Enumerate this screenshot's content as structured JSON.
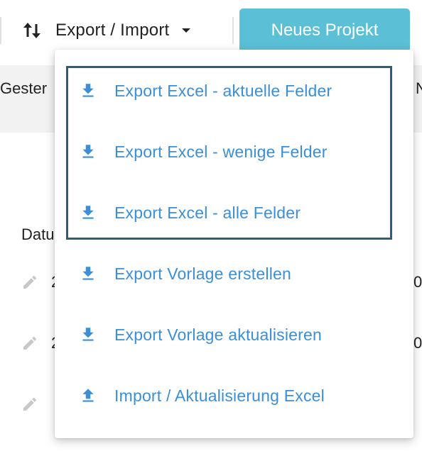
{
  "toolbar": {
    "export_import_label": "Export / Import",
    "new_project_label": "Neues Projekt"
  },
  "background": {
    "header_cell": "Gester",
    "header_cell_right": "N",
    "column_label": "Datu",
    "row_values": [
      "2",
      "2"
    ],
    "row_right_values": [
      "0",
      "0"
    ]
  },
  "dropdown": {
    "items": [
      {
        "label": "Export Excel - aktuelle Felder",
        "icon": "download-icon"
      },
      {
        "label": "Export Excel - wenige Felder",
        "icon": "download-icon"
      },
      {
        "label": "Export Excel - alle Felder",
        "icon": "download-icon"
      },
      {
        "label": "Export Vorlage erstellen",
        "icon": "download-icon"
      },
      {
        "label": "Export Vorlage aktualisieren",
        "icon": "download-icon"
      },
      {
        "label": "Import / Aktualisierung Excel",
        "icon": "upload-icon"
      }
    ]
  },
  "colors": {
    "accent": "#5bc0d6",
    "menu_text": "#3a8fd8",
    "highlight_border": "#2d5f7a"
  }
}
